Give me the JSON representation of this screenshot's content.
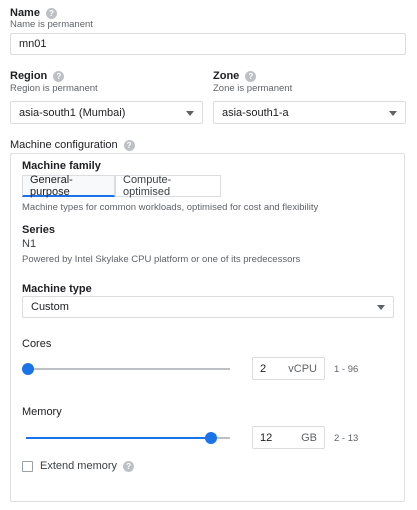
{
  "name": {
    "label": "Name",
    "helper": "Name is permanent",
    "value": "mn01"
  },
  "region": {
    "label": "Region",
    "helper": "Region is permanent",
    "value": "asia-south1 (Mumbai)"
  },
  "zone": {
    "label": "Zone",
    "helper": "Zone is permanent",
    "value": "asia-south1-a"
  },
  "machine_config": {
    "label": "Machine configuration",
    "family_label": "Machine family",
    "tabs": [
      {
        "label": "General-purpose",
        "active": true
      },
      {
        "label": "Compute-optimised",
        "active": false
      }
    ],
    "family_description": "Machine types for common workloads, optimised for cost and flexibility",
    "series_label": "Series",
    "series_value": "N1",
    "series_description": "Powered by Intel Skylake CPU platform or one of its predecessors",
    "machine_type_label": "Machine type",
    "machine_type_value": "Custom",
    "cores": {
      "label": "Cores",
      "value": "2",
      "unit": "vCPU",
      "range": "1 - 96",
      "min": 1,
      "max": 96,
      "current": 2
    },
    "memory": {
      "label": "Memory",
      "value": "12",
      "unit": "GB",
      "range": "2 - 13",
      "min": 2,
      "max": 13,
      "current": 12
    },
    "extend_memory": {
      "label": "Extend memory",
      "checked": false
    }
  },
  "colors": {
    "accent": "#1a73e8",
    "border": "#dadce0",
    "muted_text": "#5f6368"
  }
}
